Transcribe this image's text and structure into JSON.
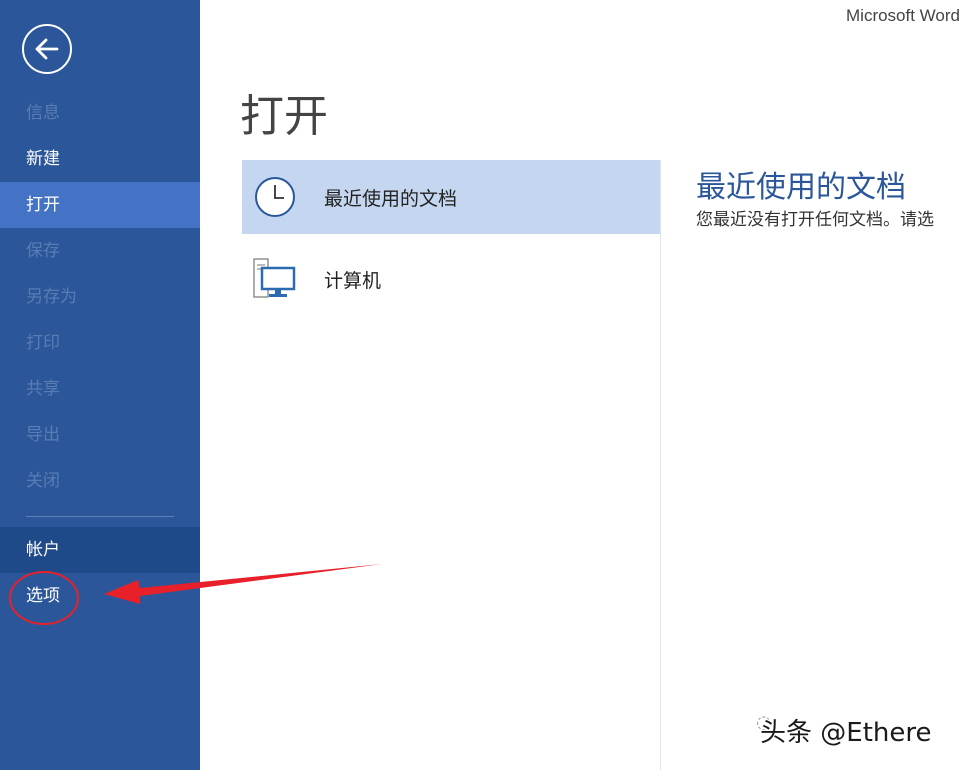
{
  "window": {
    "title": "Microsoft Word"
  },
  "sidebar": {
    "items": [
      {
        "label": "信息",
        "state": "disabled"
      },
      {
        "label": "新建",
        "state": "normal"
      },
      {
        "label": "打开",
        "state": "active"
      },
      {
        "label": "保存",
        "state": "disabled"
      },
      {
        "label": "另存为",
        "state": "disabled"
      },
      {
        "label": "打印",
        "state": "disabled"
      },
      {
        "label": "共享",
        "state": "disabled"
      },
      {
        "label": "导出",
        "state": "disabled"
      },
      {
        "label": "关闭",
        "state": "disabled"
      }
    ],
    "account": "帐户",
    "options": "选项"
  },
  "main": {
    "title": "打开",
    "places": [
      {
        "label": "最近使用的文档",
        "icon": "clock-icon",
        "selected": true
      },
      {
        "label": "计算机",
        "icon": "computer-icon",
        "selected": false
      }
    ],
    "recent": {
      "title": "最近使用的文档",
      "description": "您最近没有打开任何文档。请选"
    }
  },
  "watermark": {
    "text": "头条 @Ethere"
  },
  "colors": {
    "sidebar": "#2b579a",
    "active": "#4472c4",
    "selected": "#c5d7f0",
    "accent": "#2b579a",
    "annotation": "#e8202a"
  }
}
